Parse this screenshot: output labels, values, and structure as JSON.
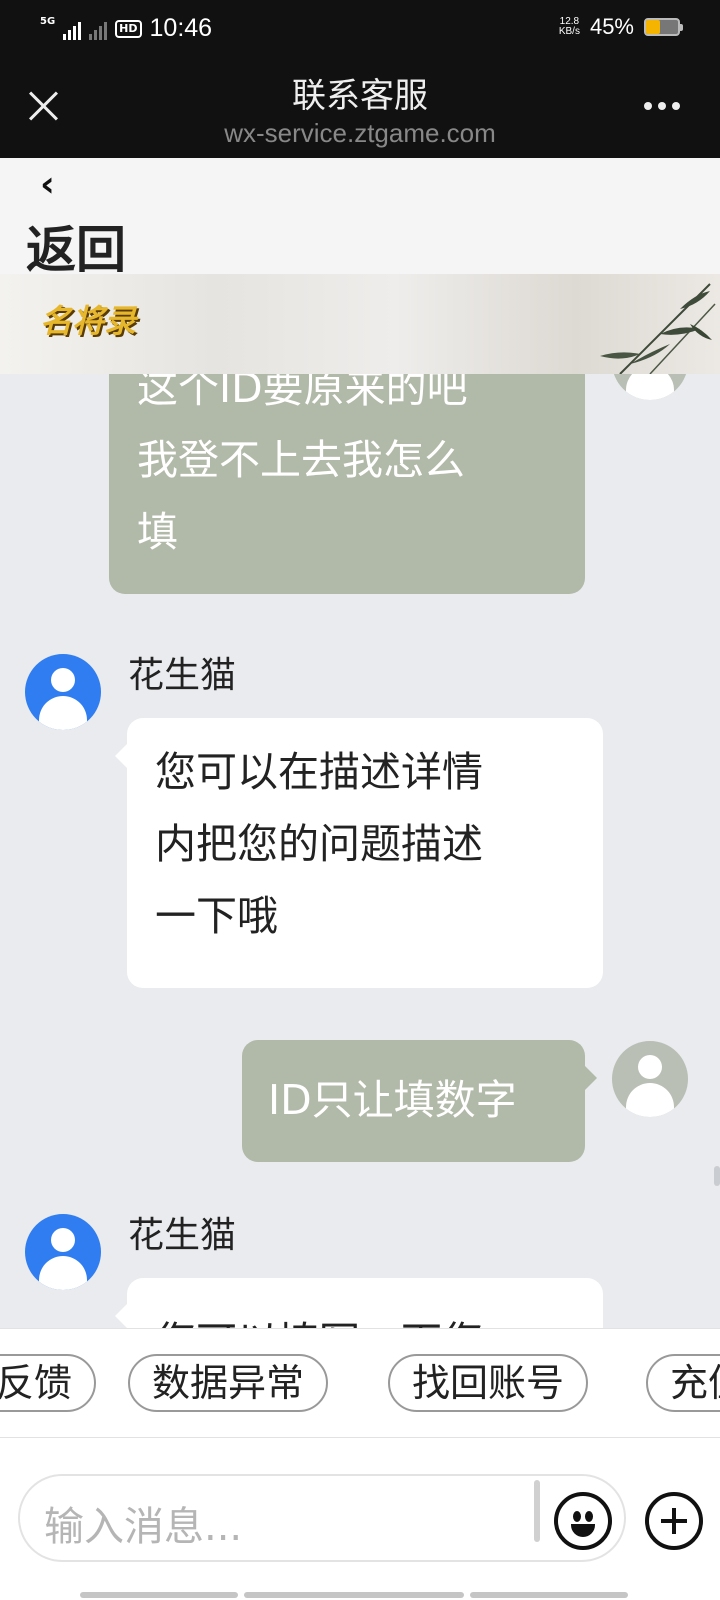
{
  "status_bar": {
    "network_label": "5G",
    "hd_label": "HD",
    "time": "10:46",
    "net_speed_value": "12.8",
    "net_speed_unit": "KB/s",
    "battery_percent": "45%",
    "battery_level": 0.45,
    "battery_color": "#f4b400"
  },
  "title_bar": {
    "title": "联系客服",
    "url": "wx-service.ztgame.com",
    "close_icon": "close-icon",
    "more_icon": "more-dots-icon"
  },
  "back_nav": {
    "chevron": "‹",
    "label": "返回"
  },
  "banner": {
    "logo_text": "名将录"
  },
  "messages": [
    {
      "from": "user",
      "text_lines": [
        "这个ID要原来的吧",
        "我登不上去我怎么",
        "填"
      ]
    },
    {
      "from": "agent",
      "sender": "花生猫",
      "text_lines": [
        "您可以在描述详情",
        "内把您的问题描述",
        "一下哦"
      ]
    },
    {
      "from": "user",
      "text_lines": [
        "ID只让填数字"
      ]
    },
    {
      "from": "agent",
      "sender": "花生猫",
      "text_lines": [
        "您可以填写一下您"
      ]
    }
  ],
  "quick_replies": [
    "反馈",
    "数据异常",
    "找回账号",
    "充值"
  ],
  "input": {
    "placeholder": "输入消息..."
  },
  "colors": {
    "user_bubble": "#b1b9a8",
    "agent_avatar": "#2f7df0",
    "chat_background": "#e9ebee"
  }
}
